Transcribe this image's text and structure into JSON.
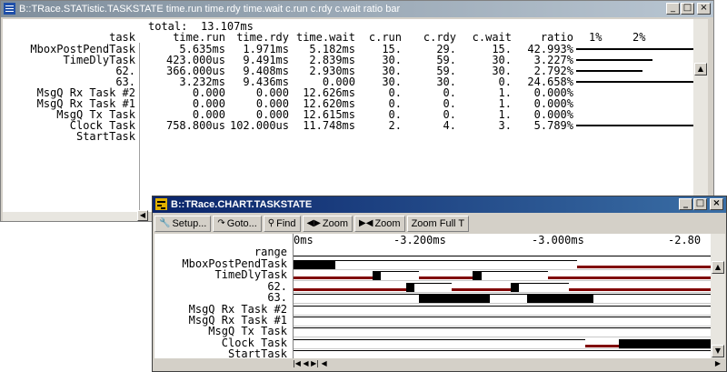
{
  "window1": {
    "title": "B::TRace.STATistic.TASKSTATE time.run time.rdy time.wait c.run c.rdy c.wait ratio bar",
    "total_label": "total:",
    "total_value": "13.107ms",
    "columns": [
      "task",
      "time.run",
      "time.rdy",
      "time.wait",
      "c.run",
      "c.rdy",
      "c.wait",
      "ratio",
      "1%",
      "2%"
    ],
    "rows": [
      {
        "task": "MboxPostPendTask",
        "time_run": "5.635ms",
        "time_rdy": "1.971ms",
        "time_wait": "5.182ms",
        "c_run": "15.",
        "c_rdy": "29.",
        "c_wait": "15.",
        "ratio": "42.993%",
        "bar": 0.4299
      },
      {
        "task": "TimeDlyTask",
        "time_run": "423.000us",
        "time_rdy": "9.491ms",
        "time_wait": "2.839ms",
        "c_run": "30.",
        "c_rdy": "59.",
        "c_wait": "30.",
        "ratio": "3.227%",
        "bar": 0.0323
      },
      {
        "task": "62.",
        "time_run": "366.000us",
        "time_rdy": "9.408ms",
        "time_wait": "2.930ms",
        "c_run": "30.",
        "c_rdy": "59.",
        "c_wait": "30.",
        "ratio": "2.792%",
        "bar": 0.0279
      },
      {
        "task": "63.",
        "time_run": "3.232ms",
        "time_rdy": "9.436ms",
        "time_wait": "0.000",
        "c_run": "30.",
        "c_rdy": "30.",
        "c_wait": "0.",
        "ratio": "24.658%",
        "bar": 0.2466
      },
      {
        "task": "MsgQ Rx Task #2",
        "time_run": "0.000",
        "time_rdy": "0.000",
        "time_wait": "12.626ms",
        "c_run": "0.",
        "c_rdy": "0.",
        "c_wait": "1.",
        "ratio": "0.000%",
        "bar": 0
      },
      {
        "task": "MsgQ Rx Task #1",
        "time_run": "0.000",
        "time_rdy": "0.000",
        "time_wait": "12.620ms",
        "c_run": "0.",
        "c_rdy": "0.",
        "c_wait": "1.",
        "ratio": "0.000%",
        "bar": 0
      },
      {
        "task": "MsgQ Tx Task",
        "time_run": "0.000",
        "time_rdy": "0.000",
        "time_wait": "12.615ms",
        "c_run": "0.",
        "c_rdy": "0.",
        "c_wait": "1.",
        "ratio": "0.000%",
        "bar": 0
      },
      {
        "task": "Clock Task",
        "time_run": "758.800us",
        "time_rdy": "102.000us",
        "time_wait": "11.748ms",
        "c_run": "2.",
        "c_rdy": "4.",
        "c_wait": "3.",
        "ratio": "5.789%",
        "bar": 0.0579
      },
      {
        "task": "StartTask",
        "time_run": "",
        "time_rdy": "",
        "time_wait": "",
        "c_run": "",
        "c_rdy": "",
        "c_wait": "",
        "ratio": "",
        "bar": 0
      }
    ]
  },
  "window2": {
    "title": "B::TRace.CHART.TASKSTATE",
    "toolbar": {
      "setup": "Setup...",
      "goto": "Goto...",
      "find": "Find",
      "zoom_in": "Zoom",
      "zoom_out": "Zoom",
      "zoom_full": "Zoom Full T"
    },
    "range_label": "range",
    "ticks": [
      "0ms",
      "-3.200ms",
      "-3.000ms",
      "-2.80"
    ],
    "tasks": [
      "MboxPostPendTask",
      "TimeDlyTask",
      "62.",
      "63.",
      "MsgQ Rx Task #2",
      "MsgQ Rx Task #1",
      "MsgQ Tx Task",
      "Clock Task",
      "StartTask"
    ],
    "chart_data": {
      "type": "gantt",
      "state_legend": {
        "run": "#000000",
        "wait": "#800000",
        "ready": "#000000"
      },
      "tracks": [
        {
          "task": "MboxPostPendTask",
          "segments": [
            [
              "run",
              0.0,
              0.1
            ],
            [
              "ready",
              0.1,
              0.68
            ],
            [
              "wait",
              0.68,
              1.0
            ]
          ]
        },
        {
          "task": "TimeDlyTask",
          "segments": [
            [
              "wait",
              0.0,
              0.19
            ],
            [
              "run",
              0.19,
              0.21
            ],
            [
              "ready",
              0.21,
              0.3
            ],
            [
              "wait",
              0.3,
              0.43
            ],
            [
              "run",
              0.43,
              0.45
            ],
            [
              "ready",
              0.45,
              0.61
            ],
            [
              "wait",
              0.61,
              1.0
            ]
          ]
        },
        {
          "task": "62.",
          "segments": [
            [
              "wait",
              0.0,
              0.27
            ],
            [
              "run",
              0.27,
              0.29
            ],
            [
              "ready",
              0.29,
              0.38
            ],
            [
              "wait",
              0.38,
              0.52
            ],
            [
              "run",
              0.52,
              0.54
            ],
            [
              "ready",
              0.54,
              0.66
            ],
            [
              "wait",
              0.66,
              1.0
            ]
          ]
        },
        {
          "task": "63.",
          "segments": [
            [
              "ready",
              0.0,
              0.3
            ],
            [
              "run",
              0.3,
              0.47
            ],
            [
              "ready",
              0.47,
              0.56
            ],
            [
              "run",
              0.56,
              0.72
            ],
            [
              "ready",
              0.72,
              1.0
            ]
          ]
        },
        {
          "task": "MsgQ Rx Task #2",
          "segments": [
            [
              "ready",
              0.0,
              1.0
            ]
          ]
        },
        {
          "task": "MsgQ Rx Task #1",
          "segments": [
            [
              "ready",
              0.0,
              1.0
            ]
          ]
        },
        {
          "task": "MsgQ Tx Task",
          "segments": [
            [
              "ready",
              0.0,
              1.0
            ]
          ]
        },
        {
          "task": "Clock Task",
          "segments": [
            [
              "ready",
              0.0,
              0.7
            ],
            [
              "wait",
              0.7,
              0.78
            ],
            [
              "run",
              0.78,
              1.0
            ]
          ]
        },
        {
          "task": "StartTask",
          "segments": [
            [
              "ready",
              0.0,
              1.0
            ]
          ]
        }
      ]
    }
  },
  "colors": {
    "title_active": "#0a246a",
    "title_inactive": "#7f8e9c",
    "wait": "#800000",
    "face": "#d4d0c8"
  }
}
